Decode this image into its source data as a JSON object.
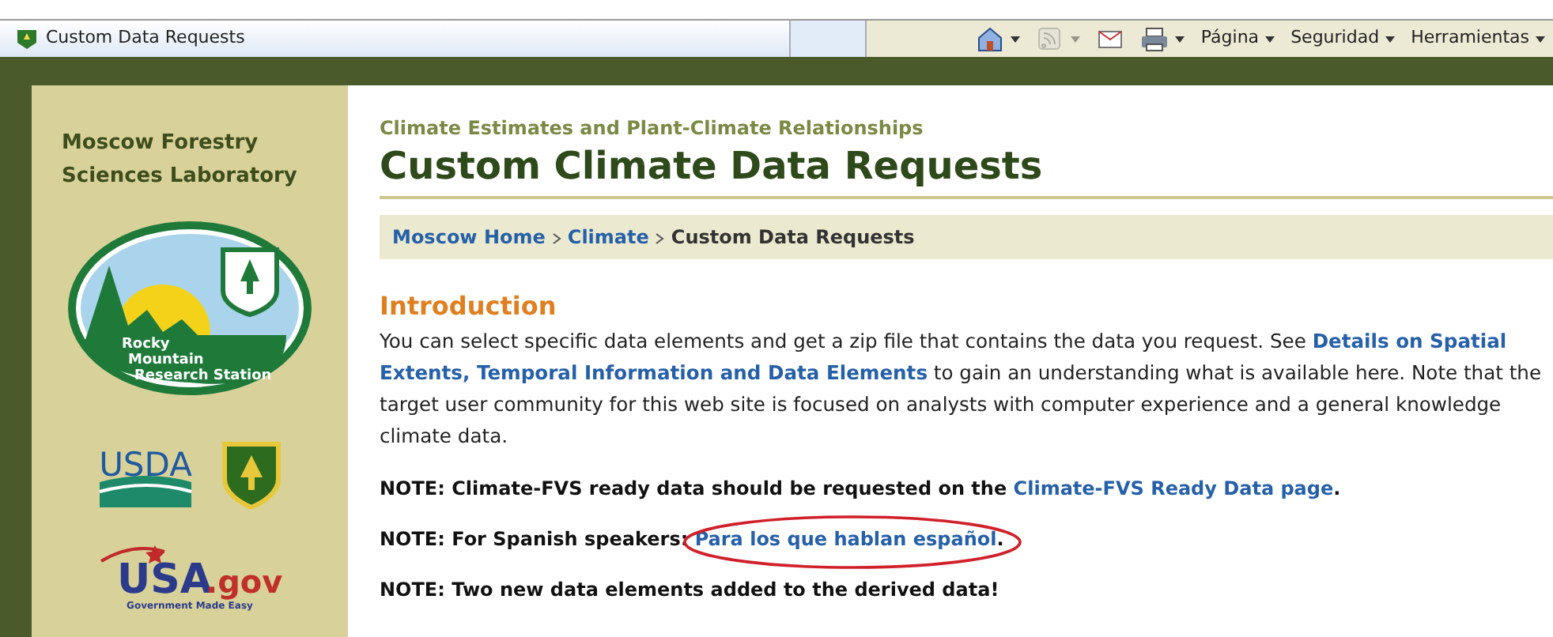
{
  "browser": {
    "tab_title": "Custom Data Requests",
    "toolbar": [
      {
        "kind": "home",
        "dropdown": true,
        "disabled": false
      },
      {
        "kind": "feed",
        "dropdown": true,
        "disabled": true
      },
      {
        "kind": "mail",
        "dropdown": false,
        "disabled": false
      },
      {
        "kind": "print",
        "dropdown": true,
        "disabled": false
      },
      {
        "kind": "menu",
        "label": "Página",
        "dropdown": true,
        "disabled": false
      },
      {
        "kind": "menu",
        "label": "Seguridad",
        "dropdown": true,
        "disabled": false
      },
      {
        "kind": "menu",
        "label": "Herramientas",
        "dropdown": true,
        "disabled": false
      }
    ]
  },
  "sidebar": {
    "lab_name": [
      "Moscow Forestry",
      "Sciences Laboratory"
    ],
    "station_logo": {
      "lines": [
        "Rocky",
        "Mountain",
        "Research Station"
      ]
    },
    "usda_logo": {
      "text": "USDA"
    },
    "usagov_logo": {
      "text": "USA",
      "suffix": ".gov",
      "tagline": "Government Made Easy"
    }
  },
  "header": {
    "kicker": "Climate Estimates and Plant-Climate Relationships",
    "title": "Custom Climate Data Requests"
  },
  "breadcrumb": [
    {
      "label": "Moscow Home",
      "link": true
    },
    {
      "label": "Climate",
      "link": true
    },
    {
      "label": "Custom Data Requests",
      "link": false
    }
  ],
  "intro": {
    "heading": "Introduction",
    "lines": [
      [
        {
          "text": "You can select specific data elements and get a zip file that contains the data you request. See "
        },
        {
          "link": "Details on Spatial"
        }
      ],
      [
        {
          "link": "Extents, Temporal Information and Data Elements"
        },
        {
          "text": " to gain an understanding what is available here. Note that the"
        }
      ],
      [
        {
          "text": "target user community for this web site is focused on analysts with computer experience and a general knowledge"
        }
      ],
      [
        {
          "text": "climate data."
        }
      ]
    ]
  },
  "notes": [
    {
      "parts": [
        {
          "text": "NOTE: Climate-FVS ready data should be requested on the "
        },
        {
          "link": "Climate-FVS Ready Data page"
        },
        {
          "text": "."
        }
      ],
      "circled": false
    },
    {
      "parts": [
        {
          "text": "NOTE: For Spanish speakers: "
        },
        {
          "link": "Para los que hablan español"
        },
        {
          "text": "."
        }
      ],
      "circled": true
    },
    {
      "parts": [
        {
          "text": "NOTE: Two new data elements added to the derived data!"
        }
      ],
      "circled": false
    }
  ]
}
